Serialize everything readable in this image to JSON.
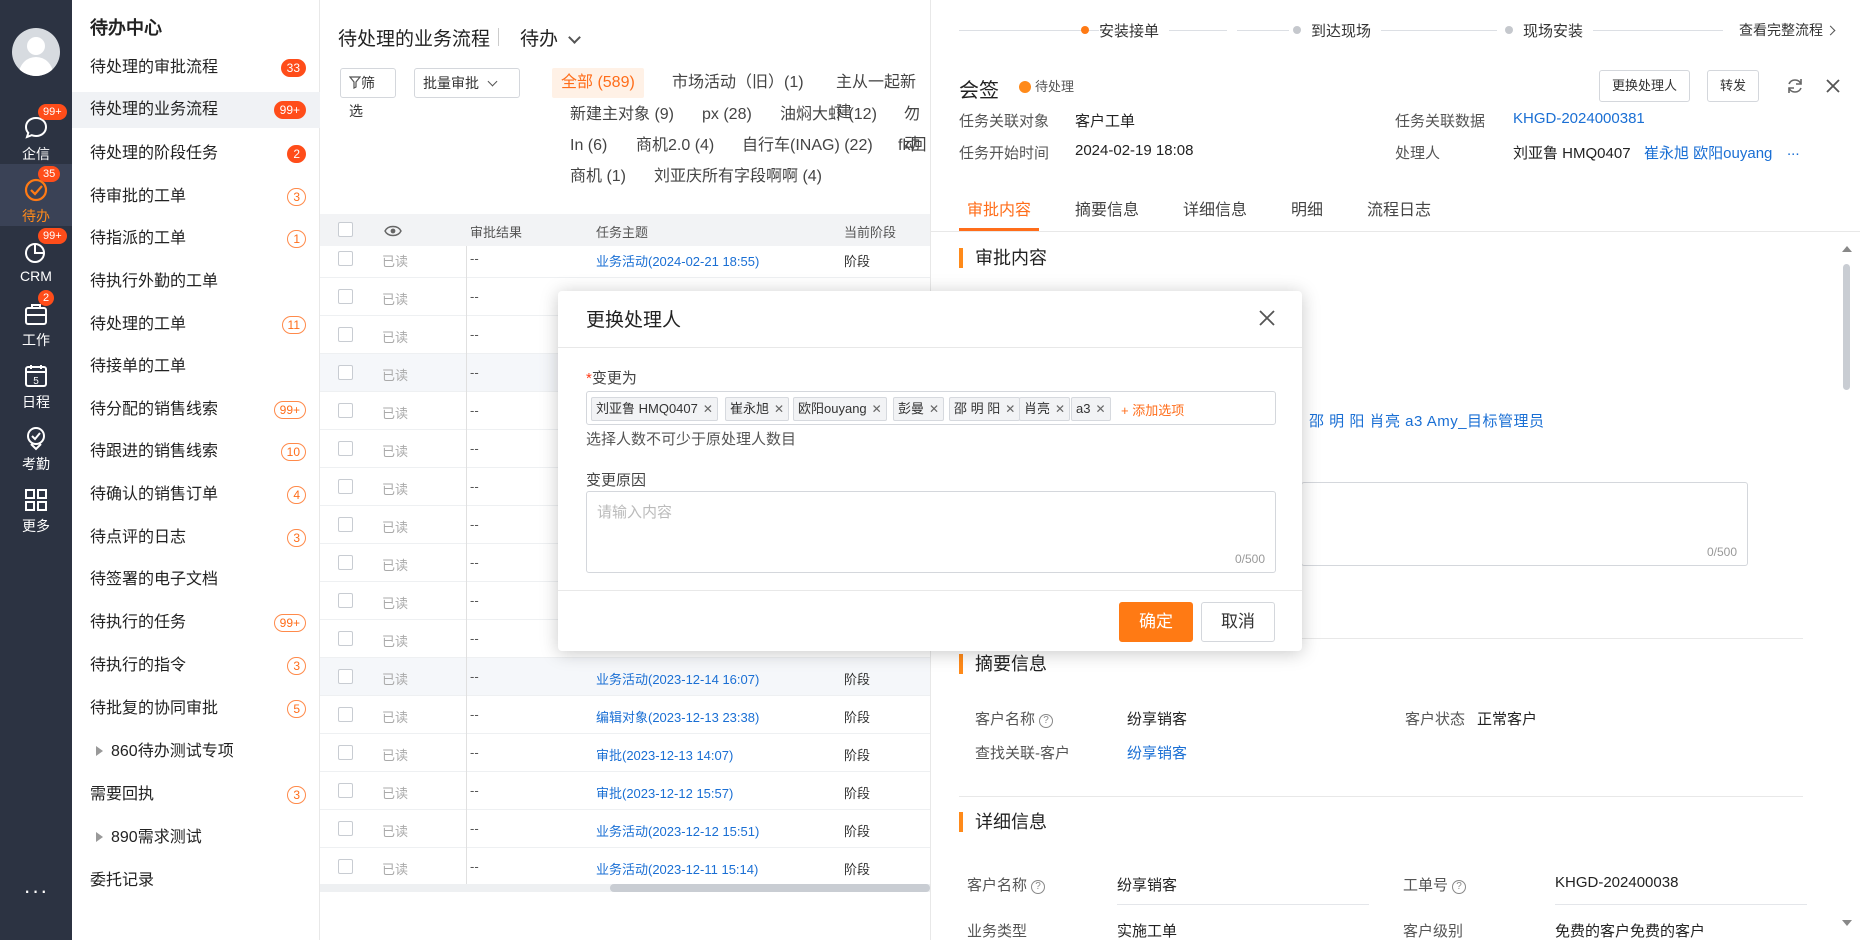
{
  "nav": {
    "items": [
      {
        "label": "企信",
        "badge": "99+",
        "icon": "chat-icon"
      },
      {
        "label": "待办",
        "badge": "35",
        "icon": "todo-check-icon"
      },
      {
        "label": "CRM",
        "badge": "99+",
        "icon": "crm-pie-icon"
      },
      {
        "label": "工作",
        "badge": "2",
        "icon": "briefcase-icon"
      },
      {
        "label": "日程",
        "badge": "",
        "icon": "calendar-icon",
        "day": "5"
      },
      {
        "label": "考勤",
        "badge": "",
        "icon": "location-icon"
      },
      {
        "label": "更多",
        "badge": "",
        "icon": "grid-icon"
      }
    ],
    "more": "···"
  },
  "sidebar": {
    "title": "待办中心",
    "items": [
      {
        "label": "待处理的审批流程",
        "badge": "33"
      },
      {
        "label": "待处理的业务流程",
        "badge": "99+"
      },
      {
        "label": "待处理的阶段任务",
        "badge": "2"
      },
      {
        "label": "待审批的工单",
        "badge": "3"
      },
      {
        "label": "待指派的工单",
        "badge": "1"
      },
      {
        "label": "待执行外勤的工单",
        "badge": ""
      },
      {
        "label": "待处理的工单",
        "badge": "11"
      },
      {
        "label": "待接单的工单",
        "badge": ""
      },
      {
        "label": "待分配的销售线索",
        "badge": "99+"
      },
      {
        "label": "待跟进的销售线索",
        "badge": "10"
      },
      {
        "label": "待确认的销售订单",
        "badge": "4"
      },
      {
        "label": "待点评的日志",
        "badge": "3"
      },
      {
        "label": "待签署的电子文档",
        "badge": ""
      },
      {
        "label": "待执行的任务",
        "badge": "99+"
      },
      {
        "label": "待执行的指令",
        "badge": "3"
      },
      {
        "label": "待批复的协同审批",
        "badge": "5"
      },
      {
        "label": "860待办测试专项",
        "badge": ""
      },
      {
        "label": "需要回执",
        "badge": "3"
      },
      {
        "label": "890需求测试",
        "badge": ""
      },
      {
        "label": "委托记录",
        "badge": ""
      }
    ]
  },
  "list": {
    "title": "待处理的业务流程",
    "mode": "待办",
    "filter_label": "筛选",
    "batch_label": "批量审批",
    "chips": [
      "全部 (589)",
      "市场活动（旧）(1)",
      "主从一起新建",
      "新建主对象 (9)",
      "px (28)",
      "油焖大虾 (12)",
      "勿动",
      "In (6)",
      "商机2.0 (4)",
      "自行车(INAG) (22)",
      "fk回",
      "商机 (1)",
      "刘亚庆所有字段啊啊 (4)"
    ],
    "columns": [
      "审批结果",
      "任务主题",
      "当前阶段"
    ],
    "rows": [
      {
        "read": "已读",
        "result": "--",
        "subject": "业务活动(2024-02-21 18:55)",
        "stage": "阶段"
      },
      {
        "read": "已读",
        "result": "--",
        "subject": "",
        "stage": ""
      },
      {
        "read": "已读",
        "result": "--",
        "subject": "",
        "stage": ""
      },
      {
        "read": "已读",
        "result": "--",
        "subject": "",
        "stage": ""
      },
      {
        "read": "已读",
        "result": "--",
        "subject": "",
        "stage": ""
      },
      {
        "read": "已读",
        "result": "--",
        "subject": "",
        "stage": ""
      },
      {
        "read": "已读",
        "result": "--",
        "subject": "",
        "stage": ""
      },
      {
        "read": "已读",
        "result": "--",
        "subject": "",
        "stage": ""
      },
      {
        "read": "已读",
        "result": "--",
        "subject": "",
        "stage": ""
      },
      {
        "read": "已读",
        "result": "--",
        "subject": "",
        "stage": ""
      },
      {
        "read": "已读",
        "result": "--",
        "subject": "",
        "stage": ""
      },
      {
        "read": "已读",
        "result": "--",
        "subject": "业务活动(2023-12-14 16:07)",
        "stage": "阶段"
      },
      {
        "read": "已读",
        "result": "--",
        "subject": "编辑对象(2023-12-13 23:38)",
        "stage": "阶段"
      },
      {
        "read": "已读",
        "result": "--",
        "subject": "审批(2023-12-13 14:07)",
        "stage": "阶段"
      },
      {
        "read": "已读",
        "result": "--",
        "subject": "审批(2023-12-12 15:57)",
        "stage": "阶段"
      },
      {
        "read": "已读",
        "result": "--",
        "subject": "业务活动(2023-12-12 15:51)",
        "stage": "阶段"
      },
      {
        "read": "已读",
        "result": "--",
        "subject": "业务活动(2023-12-11 15:14)",
        "stage": "阶段"
      }
    ]
  },
  "panel": {
    "steps": [
      "安装接单",
      "到达现场",
      "现场安装"
    ],
    "view_flow": "查看完整流程",
    "title": "会签",
    "status": "待处理",
    "change_handler_btn": "更换处理人",
    "forward_btn": "转发",
    "info": {
      "obj_label": "任务关联对象",
      "obj_value": "客户工单",
      "data_label": "任务关联数据",
      "data_value": "KHGD-2024000381",
      "time_label": "任务开始时间",
      "time_value": "2024-02-19 18:08",
      "handler_label": "处理人",
      "handler_first": "刘亚鲁 HMQ0407",
      "handler_links": "崔永旭 欧阳ouyang",
      "handler_more": "..."
    },
    "tabs": [
      "审批内容",
      "摘要信息",
      "详细信息",
      "明细",
      "流程日志"
    ],
    "approval_title": "审批内容",
    "approvers_visible": "邵 明 阳  肖亮  a3  Amy_目标管理员",
    "approval_counter": "0/500",
    "summary_title": "摘要信息",
    "summary": {
      "cust_label": "客户名称",
      "cust_value": "纷享销客",
      "state_label": "客户状态",
      "state_value": "正常客户",
      "find_label": "查找关联-客户",
      "find_value": "纷享销客"
    },
    "detail_title": "详细信息",
    "detail": {
      "cust_label": "客户名称",
      "cust_value": "纷享销客",
      "no_label": "工单号",
      "no_value": "KHGD-202400038",
      "type_label": "业务类型",
      "type_value": "实施工单",
      "level_label": "客户级别",
      "level_value": "免费的客户免费的客户"
    }
  },
  "modal": {
    "title": "更换处理人",
    "change_to_label": "变更为",
    "tags": [
      "刘亚鲁 HMQ0407",
      "崔永旭",
      "欧阳ouyang",
      "彭曼",
      "邵 明 阳",
      "肖亮",
      "a3"
    ],
    "add_option": "+ 添加选项",
    "hint": "选择人数不可少于原处理人数目",
    "reason_label": "变更原因",
    "reason_placeholder": "请输入内容",
    "reason_counter": "0/500",
    "ok": "确定",
    "cancel": "取消"
  },
  "colors": {
    "nav_bg": "#2c3342",
    "accent": "#ff7a14",
    "link": "#1a6fd4",
    "badge": "#ff4d1a"
  }
}
